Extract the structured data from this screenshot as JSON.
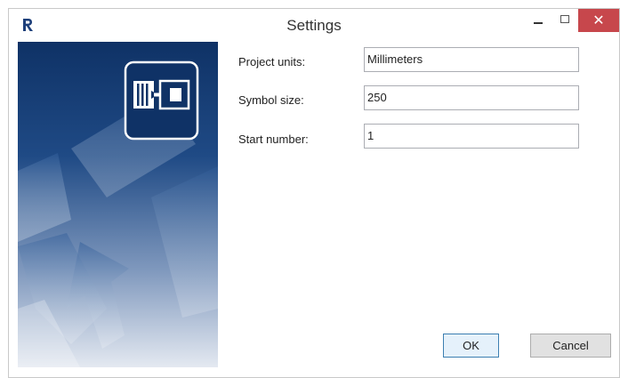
{
  "window": {
    "title": "Settings",
    "minimize_glyph": "–",
    "close_glyph": "✕"
  },
  "icons": {
    "app": "revit-logo-icon",
    "banner": "numbering-symbol-icon"
  },
  "colors": {
    "banner_dark": "#0f3266",
    "banner_light": "#e4e9f1",
    "close_red": "#c7474c",
    "ok_border": "#3c7fb1"
  },
  "fields": [
    {
      "label": "Project units:",
      "value": "Millimeters"
    },
    {
      "label": "Symbol size:",
      "value": "250"
    },
    {
      "label": "Start number:",
      "value": "1"
    }
  ],
  "buttons": {
    "ok": "OK",
    "cancel": "Cancel"
  }
}
